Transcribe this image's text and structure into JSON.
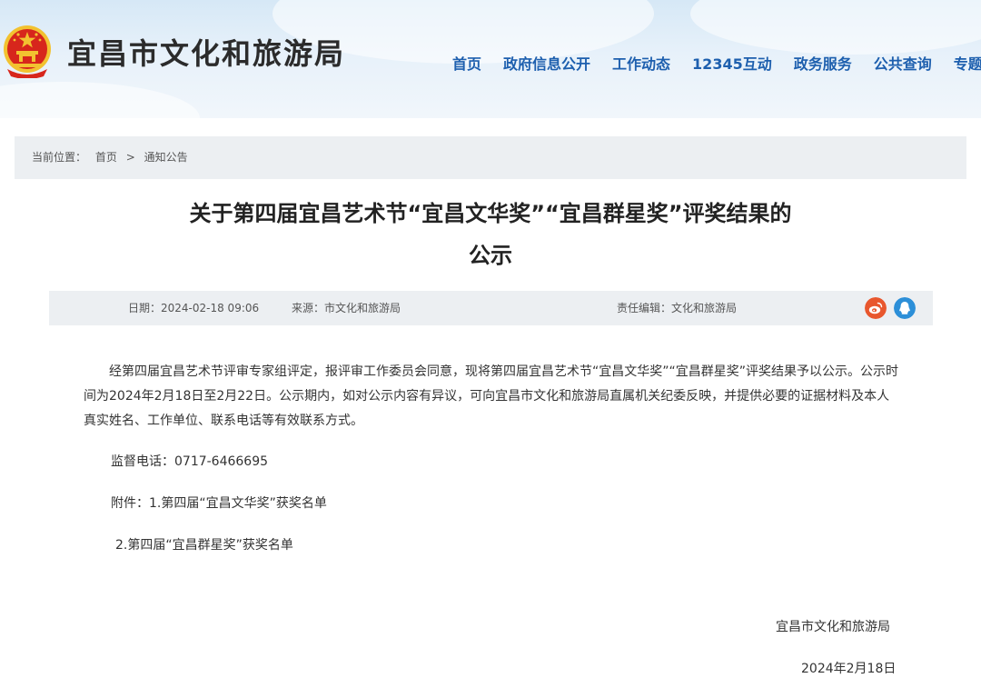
{
  "header": {
    "site_title": "宜昌市文化和旅游局",
    "emblem_icon": "national-emblem-icon",
    "nav": [
      {
        "label": "首页"
      },
      {
        "label": "政府信息公开"
      },
      {
        "label": "工作动态"
      },
      {
        "label": "12345互动"
      },
      {
        "label": "政务服务"
      },
      {
        "label": "公共查询"
      },
      {
        "label": "专题专栏"
      }
    ]
  },
  "breadcrumb": {
    "prefix": "当前位置：",
    "home": "首页",
    "separator": ">",
    "current": "通知公告"
  },
  "article": {
    "title_line1": "关于第四届宜昌艺术节“宜昌文华奖”“宜昌群星奖”评奖结果的",
    "title_line2": "公示",
    "meta": {
      "date": "日期：2024-02-18 09:06",
      "source": "来源：市文化和旅游局",
      "editor": "责任编辑：文化和旅游局"
    },
    "share_icons": [
      "weibo-icon",
      "qq-icon"
    ],
    "paragraph": "经第四届宜昌艺术节评审专家组评定，报评审工作委员会同意，现将第四届宜昌艺术节“宜昌文华奖”“宜昌群星奖”评奖结果予以公示。公示时间为2024年2月18日至2月22日。公示期内，如对公示内容有异议，可向宜昌市文化和旅游局直属机关纪委反映，并提供必要的证据材料及本人真实姓名、工作单位、联系电话等有效联系方式。",
    "phone": "监督电话：0717-6466695",
    "attachment1": "附件：1.第四届“宜昌文华奖”获奖名单",
    "attachment2": "2.第四届“宜昌群星奖”获奖名单",
    "signature_org": "宜昌市文化和旅游局",
    "signature_date": "2024年2月18日"
  },
  "colors": {
    "nav_text": "#1d5fae",
    "bar_bg": "#eceff2",
    "emblem_red": "#d7261c",
    "emblem_gold": "#f2c230",
    "weibo": "#e8572e",
    "qq": "#2c8fd8"
  }
}
